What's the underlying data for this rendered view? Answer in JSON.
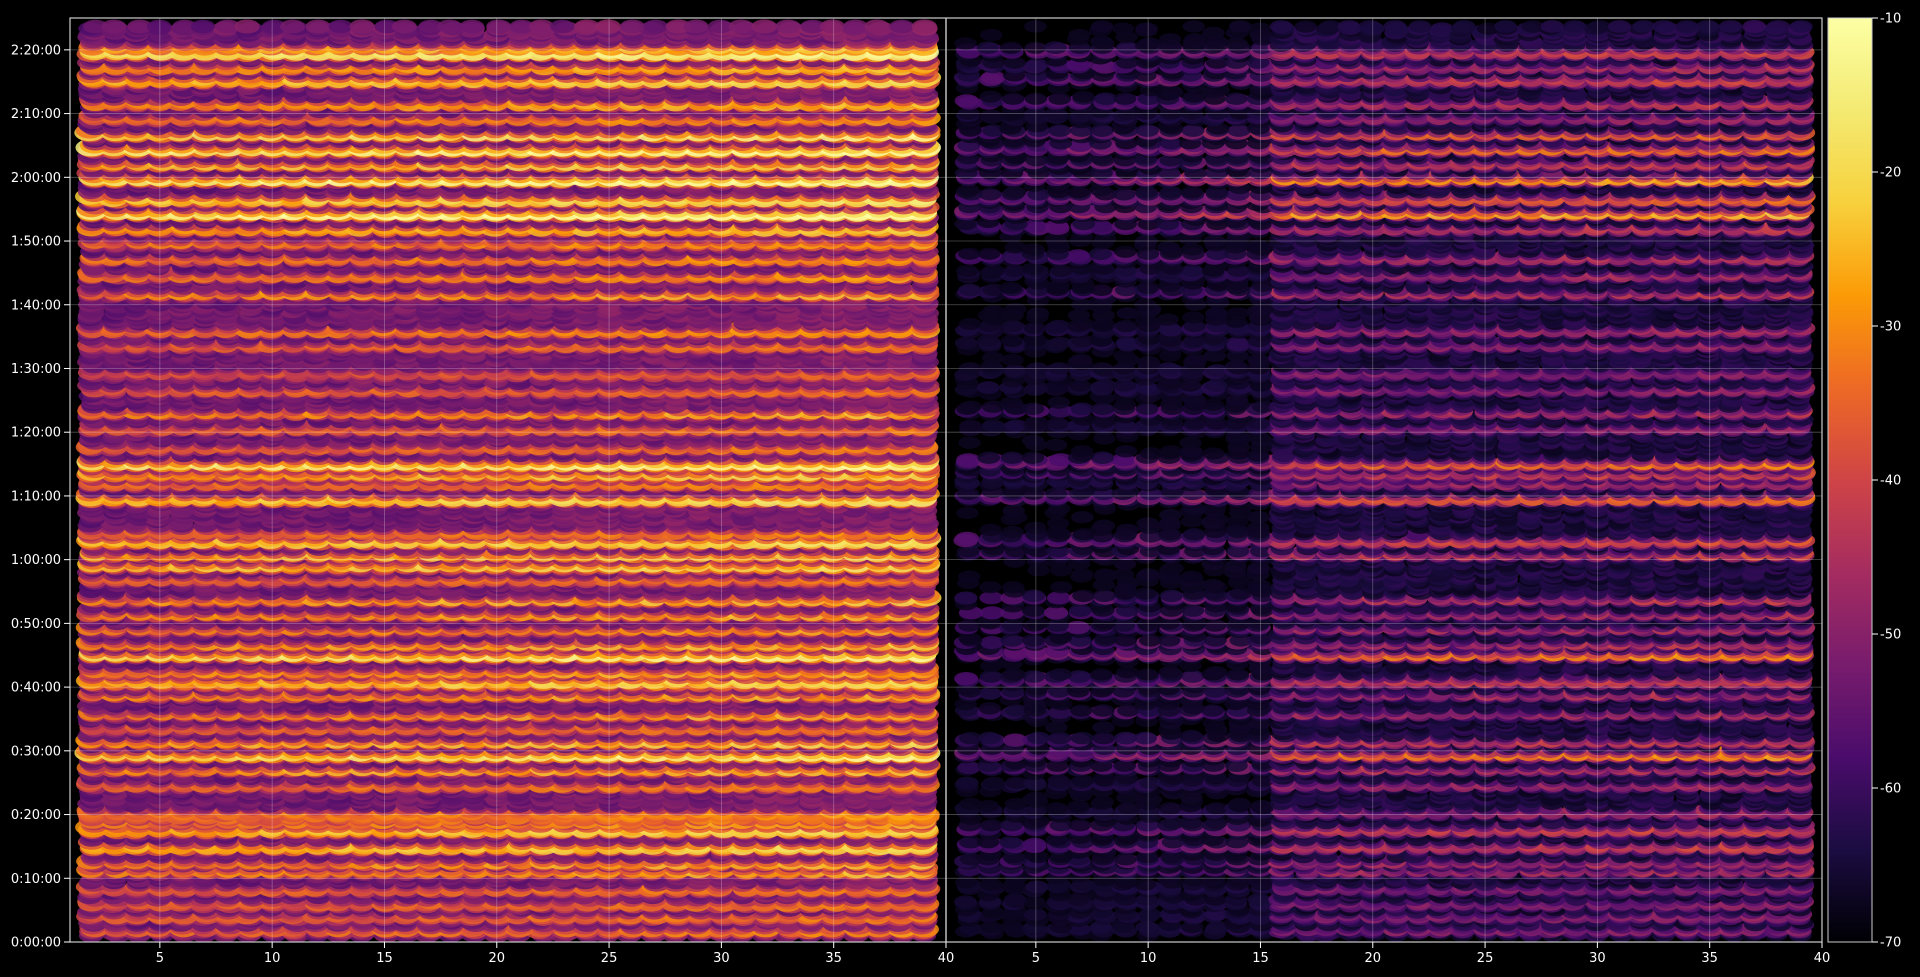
{
  "chart_data": {
    "type": "heatmap",
    "title": "",
    "xlabel": "",
    "ylabel": "",
    "background": "#000000",
    "grid": true,
    "colormap": "inferno",
    "colorbar": {
      "position": "right",
      "range": [
        -70,
        -10
      ],
      "ticks": [
        -70,
        -60,
        -50,
        -40,
        -30,
        -20,
        -10
      ],
      "tick_labels": [
        "-70",
        "-60",
        "-50",
        "-40",
        "-30",
        "-20",
        "-10"
      ]
    },
    "y_axis": {
      "unit": "time",
      "range_seconds": [
        0,
        8700
      ],
      "ticks": [
        0,
        600,
        1200,
        1800,
        2400,
        3000,
        3600,
        4200,
        4800,
        5400,
        6000,
        6600,
        7200,
        7800,
        8400
      ],
      "tick_labels": [
        "0:00:00",
        "0:10:00",
        "0:20:00",
        "0:30:00",
        "0:40:00",
        "0:50:00",
        "1:00:00",
        "1:10:00",
        "1:20:00",
        "1:30:00",
        "1:40:00",
        "1:50:00",
        "2:00:00",
        "2:10:00",
        "2:20:00"
      ]
    },
    "panels": [
      {
        "name": "left",
        "x_range": [
          1,
          40
        ],
        "x_ticks": [
          5,
          10,
          15,
          20,
          25,
          30,
          35,
          40
        ],
        "x_tick_labels": [
          "5",
          "10",
          "15",
          "20",
          "25",
          "30",
          "35",
          "40"
        ],
        "columns": [
          2,
          39
        ],
        "rows": {
          "strong": [
            [
              6880,
              1.0
            ],
            [
              7200,
              0.95
            ],
            [
              7010,
              0.85
            ],
            [
              7480,
              0.9
            ],
            [
              8390,
              1.0
            ],
            [
              8130,
              0.8
            ],
            [
              4190,
              0.85
            ],
            [
              4520,
              0.9
            ],
            [
              4420,
              0.65
            ],
            [
              3790,
              0.85
            ],
            [
              1780,
              0.85
            ],
            [
              2720,
              0.85
            ],
            [
              2470,
              0.8
            ],
            [
              2560,
              0.55
            ],
            [
              910,
              0.8
            ],
            [
              1070,
              0.8
            ],
            [
              2450,
              0.55
            ],
            [
              3560,
              0.7
            ],
            [
              7470,
              0.6
            ],
            [
              6600,
              0.5
            ],
            [
              5370,
              0.4
            ]
          ],
          "medium": [
            [
              7620,
              0.8
            ],
            [
              7340,
              0.7
            ],
            [
              6730,
              0.75
            ],
            [
              6450,
              0.6
            ],
            [
              6290,
              0.6
            ],
            [
              6120,
              0.55
            ],
            [
              5770,
              0.6
            ],
            [
              8250,
              0.7
            ],
            [
              8440,
              0.6
            ],
            [
              7910,
              0.7
            ],
            [
              7770,
              0.6
            ],
            [
              5630,
              0.5
            ],
            [
              5210,
              0.5
            ],
            [
              5000,
              0.55
            ],
            [
              4850,
              0.5
            ],
            [
              4670,
              0.5
            ],
            [
              4330,
              0.55
            ],
            [
              3660,
              0.65
            ],
            [
              3240,
              0.6
            ],
            [
              3100,
              0.55
            ],
            [
              2960,
              0.5
            ],
            [
              2820,
              0.6
            ],
            [
              2340,
              0.55
            ],
            [
              2160,
              0.55
            ],
            [
              2030,
              0.5
            ],
            [
              1900,
              0.65
            ],
            [
              1640,
              0.6
            ],
            [
              1490,
              0.55
            ],
            [
              1230,
              0.6
            ],
            [
              1190,
              0.55
            ],
            [
              1140,
              0.5
            ],
            [
              760,
              0.55
            ],
            [
              680,
              0.55
            ],
            [
              510,
              0.5
            ],
            [
              370,
              0.5
            ],
            [
              250,
              0.5
            ],
            [
              120,
              0.45
            ],
            [
              3870,
              0.55
            ],
            [
              3430,
              0.5
            ]
          ]
        }
      },
      {
        "name": "right",
        "x_range": [
          1,
          40
        ],
        "x_ticks": [
          5,
          10,
          15,
          20,
          25,
          30,
          35,
          40
        ],
        "x_tick_labels": [
          "5",
          "10",
          "15",
          "20",
          "25",
          "30",
          "35",
          "40"
        ],
        "columns": [
          2,
          39
        ],
        "rows": {
          "strong": [
            [
              6880,
              0.95
            ],
            [
              7200,
              0.9
            ],
            [
              7010,
              0.8
            ],
            [
              7480,
              0.75
            ],
            [
              8390,
              0.65
            ],
            [
              8130,
              0.65
            ],
            [
              4190,
              0.8
            ],
            [
              4520,
              0.75
            ],
            [
              4420,
              0.55
            ],
            [
              3790,
              0.7
            ],
            [
              1780,
              0.8
            ],
            [
              2720,
              0.8
            ],
            [
              2470,
              0.65
            ],
            [
              910,
              0.65
            ],
            [
              1070,
              0.65
            ],
            [
              7340,
              0.55
            ],
            [
              5370,
              0.4
            ]
          ],
          "medium": [
            [
              7620,
              0.7
            ],
            [
              6730,
              0.6
            ],
            [
              6450,
              0.55
            ],
            [
              6290,
              0.5
            ],
            [
              6120,
              0.5
            ],
            [
              5770,
              0.5
            ],
            [
              8250,
              0.55
            ],
            [
              7910,
              0.6
            ],
            [
              7770,
              0.5
            ],
            [
              5630,
              0.45
            ],
            [
              5210,
              0.45
            ],
            [
              5000,
              0.45
            ],
            [
              4850,
              0.45
            ],
            [
              4330,
              0.5
            ],
            [
              3660,
              0.55
            ],
            [
              3240,
              0.5
            ],
            [
              3100,
              0.45
            ],
            [
              2960,
              0.45
            ],
            [
              2820,
              0.5
            ],
            [
              2340,
              0.45
            ],
            [
              2160,
              0.45
            ],
            [
              1900,
              0.55
            ],
            [
              1640,
              0.5
            ],
            [
              1490,
              0.5
            ],
            [
              1230,
              0.5
            ],
            [
              760,
              0.45
            ],
            [
              680,
              0.45
            ],
            [
              510,
              0.4
            ],
            [
              370,
              0.4
            ],
            [
              250,
              0.4
            ],
            [
              120,
              0.35
            ]
          ]
        }
      }
    ]
  }
}
